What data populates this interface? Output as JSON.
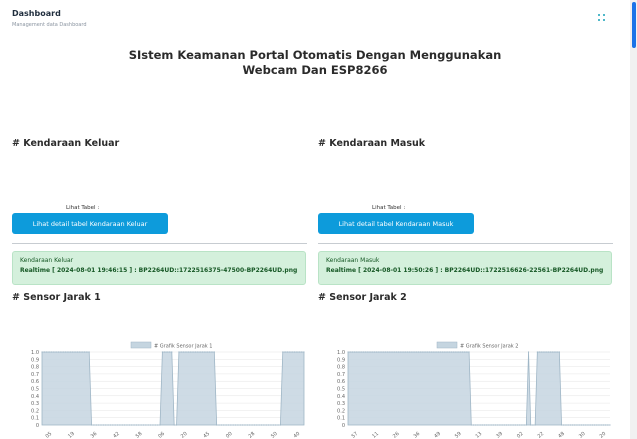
{
  "header": {
    "title": "Dashboard",
    "subtitle": "Management data Dashboard",
    "menu_icon": "dots-grid-icon"
  },
  "main": {
    "title_line1": "SIstem Keamanan Portal Otomatis Dengan Menggunakan",
    "title_line2": "Webcam Dan ESP8266"
  },
  "keluar": {
    "section_title": "# Kendaraan Keluar",
    "lihat_label": "Lihat Tabel :",
    "button_label": "Lihat detail tabel Kendaraan Keluar",
    "alert_title": "Kendaraan Keluar",
    "alert_text": "Realtime [ 2024-08-01 19:46:15 ] : BP2264UD::1722516375-47500-BP2264UD.png"
  },
  "masuk": {
    "section_title": "# Kendaraan Masuk",
    "lihat_label": "Lihat Tabel :",
    "button_label": "Lihat detail tabel Kendaraan Masuk",
    "alert_title": "Kendaraan Masuk",
    "alert_text": "Realtime [ 2024-08-01 19:50:26 ] : BP2264UD::1722516626-22561-BP2264UD.png"
  },
  "sensor1": {
    "section_title": "# Sensor Jarak 1"
  },
  "sensor2": {
    "section_title": "# Sensor Jarak 2"
  },
  "colors": {
    "button": "#0d9bdb",
    "alert_bg": "#d4f0dc",
    "chart_fill": "#c5d5e0",
    "chart_line": "#9fb6c6"
  },
  "chart_data": [
    {
      "type": "area",
      "legend": "# Grafik Sensor Jarak 1",
      "legend_position": "top",
      "y_ticks": [
        "1.0",
        "0.9",
        "0.8",
        "0.7",
        "0.6",
        "0.5",
        "0.4",
        "0.3",
        "0.2",
        "0.1",
        "0"
      ],
      "ylim": [
        0,
        1
      ],
      "x_tick_labels": [
        "05",
        "19",
        "36",
        "42",
        "58",
        "06",
        "20",
        "45",
        "00",
        "28",
        "50",
        "40"
      ],
      "values": [
        1,
        1,
        1,
        1,
        1,
        1,
        1,
        1,
        1,
        1,
        1,
        1,
        1,
        1,
        1,
        1,
        1,
        1,
        1,
        1,
        1,
        0,
        0,
        0,
        0,
        0,
        0,
        0,
        0,
        0,
        0,
        0,
        0,
        0,
        0,
        0,
        0,
        0,
        0,
        0,
        0,
        0,
        0,
        0,
        0,
        0,
        0,
        0,
        0,
        0,
        0,
        1,
        1,
        1,
        1,
        1,
        0,
        0,
        1,
        1,
        1,
        1,
        1,
        1,
        1,
        1,
        1,
        1,
        1,
        1,
        1,
        1,
        1,
        1,
        0,
        0,
        0,
        0,
        0,
        0,
        0,
        0,
        0,
        0,
        0,
        0,
        0,
        0,
        0,
        0,
        0,
        0,
        0,
        0,
        0,
        0,
        0,
        0,
        0,
        0,
        0,
        0,
        1,
        1,
        1,
        1,
        1,
        1,
        1,
        1,
        1,
        1
      ],
      "grid": true
    },
    {
      "type": "area",
      "legend": "# Grafik Sensor Jarak 2",
      "legend_position": "top",
      "y_ticks": [
        "1.0",
        "0.9",
        "0.8",
        "0.7",
        "0.6",
        "0.5",
        "0.4",
        "0.3",
        "0.2",
        "0.1",
        "0"
      ],
      "ylim": [
        0,
        1
      ],
      "x_tick_labels": [
        "57",
        "11",
        "26",
        "36",
        "49",
        "59",
        "13",
        "39",
        "02",
        "22",
        "48",
        "30",
        "20"
      ],
      "values": [
        1,
        1,
        1,
        1,
        1,
        1,
        1,
        1,
        1,
        1,
        1,
        1,
        1,
        1,
        1,
        1,
        1,
        1,
        1,
        1,
        1,
        1,
        1,
        1,
        1,
        1,
        1,
        1,
        1,
        1,
        1,
        1,
        1,
        1,
        1,
        1,
        1,
        1,
        1,
        1,
        1,
        1,
        1,
        1,
        1,
        1,
        1,
        1,
        1,
        1,
        1,
        1,
        1,
        1,
        1,
        1,
        0,
        0,
        0,
        0,
        0,
        0,
        0,
        0,
        0,
        0,
        0,
        0,
        0,
        0,
        0,
        0,
        0,
        0,
        0,
        0,
        0,
        0,
        0,
        0,
        0,
        0,
        1,
        0,
        0,
        0,
        1,
        1,
        1,
        1,
        1,
        1,
        1,
        1,
        1,
        1,
        1,
        0,
        0,
        0,
        0,
        0,
        0,
        0,
        0,
        0,
        0,
        0,
        0,
        0,
        0,
        0,
        0,
        0,
        0,
        0,
        0,
        0,
        0,
        0
      ],
      "grid": true
    }
  ]
}
